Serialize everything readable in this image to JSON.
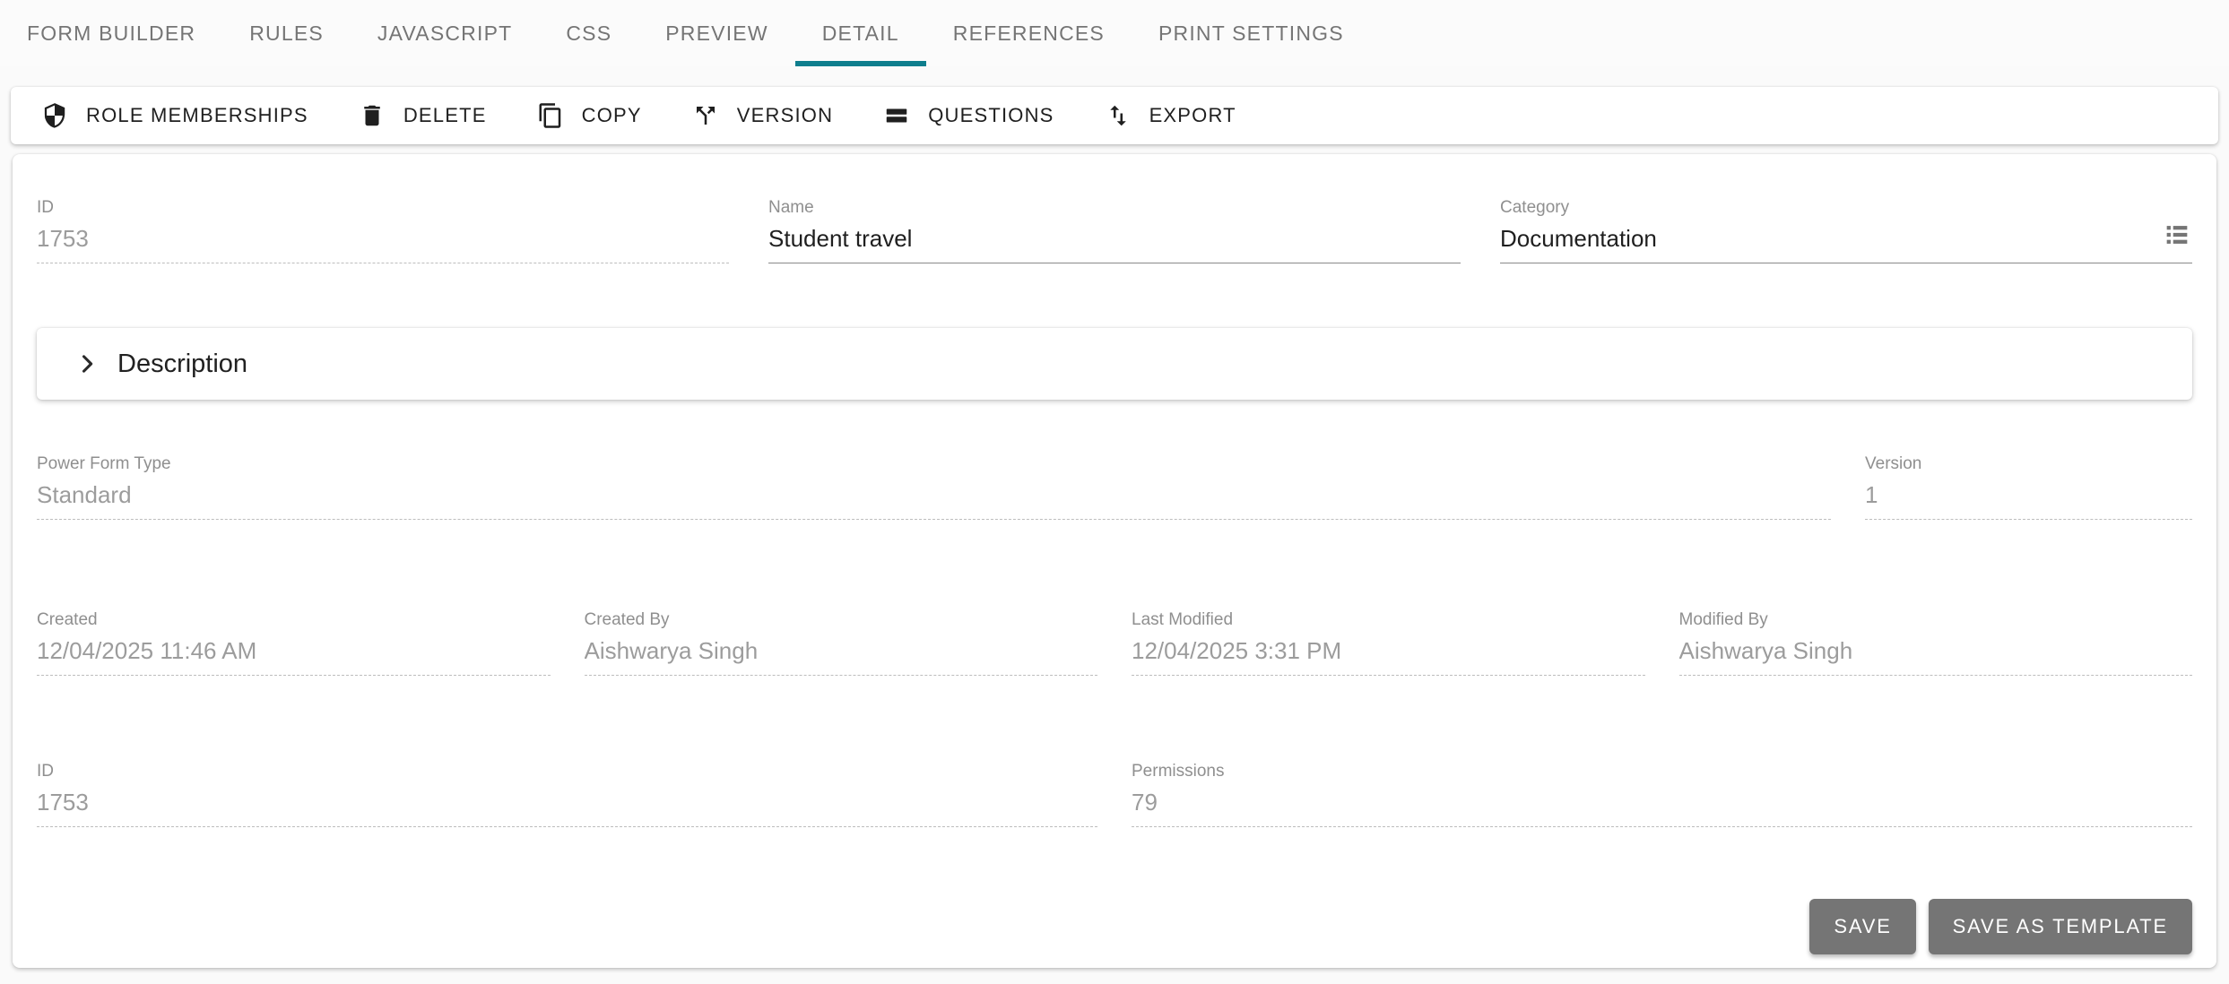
{
  "tabs": {
    "items": [
      {
        "label": "FORM BUILDER",
        "active": false
      },
      {
        "label": "RULES",
        "active": false
      },
      {
        "label": "JAVASCRIPT",
        "active": false
      },
      {
        "label": "CSS",
        "active": false
      },
      {
        "label": "PREVIEW",
        "active": false
      },
      {
        "label": "DETAIL",
        "active": true
      },
      {
        "label": "REFERENCES",
        "active": false
      },
      {
        "label": "PRINT SETTINGS",
        "active": false
      }
    ],
    "active_tab": "DETAIL"
  },
  "toolbar": {
    "buttons": [
      {
        "label": "ROLE MEMBERSHIPS",
        "icon": "shield-checkered-icon"
      },
      {
        "label": "DELETE",
        "icon": "trash-icon"
      },
      {
        "label": "COPY",
        "icon": "copy-icon"
      },
      {
        "label": "VERSION",
        "icon": "branch-split-icon"
      },
      {
        "label": "QUESTIONS",
        "icon": "stacked-rows-icon"
      },
      {
        "label": "EXPORT",
        "icon": "import-export-icon"
      }
    ]
  },
  "form": {
    "id": {
      "label": "ID",
      "value": "1753",
      "disabled": true
    },
    "name": {
      "label": "Name",
      "value": "Student travel",
      "disabled": false
    },
    "category": {
      "label": "Category",
      "value": "Documentation",
      "picker_icon": "list-picker-icon",
      "disabled": false
    },
    "description": {
      "title": "Description",
      "collapsed": true
    },
    "power_form_type": {
      "label": "Power Form Type",
      "value": "Standard",
      "disabled": true
    },
    "version": {
      "label": "Version",
      "value": "1",
      "disabled": true
    },
    "created": {
      "label": "Created",
      "value": "12/04/2025 11:46 AM",
      "disabled": true
    },
    "created_by": {
      "label": "Created By",
      "value": "Aishwarya Singh",
      "disabled": true
    },
    "last_modified": {
      "label": "Last Modified",
      "value": "12/04/2025 3:31 PM",
      "disabled": true
    },
    "modified_by": {
      "label": "Modified By",
      "value": "Aishwarya Singh",
      "disabled": true
    },
    "id_footer": {
      "label": "ID",
      "value": "1753",
      "disabled": true
    },
    "permissions": {
      "label": "Permissions",
      "value": "79",
      "disabled": true
    }
  },
  "actions": {
    "save": "SAVE",
    "save_as_template": "SAVE AS TEMPLATE"
  },
  "colors": {
    "accent_teal": "#0e7e8d",
    "button_gray": "#757575",
    "page_background": "#fafafa",
    "disabled_text": "#9c9c9c"
  }
}
